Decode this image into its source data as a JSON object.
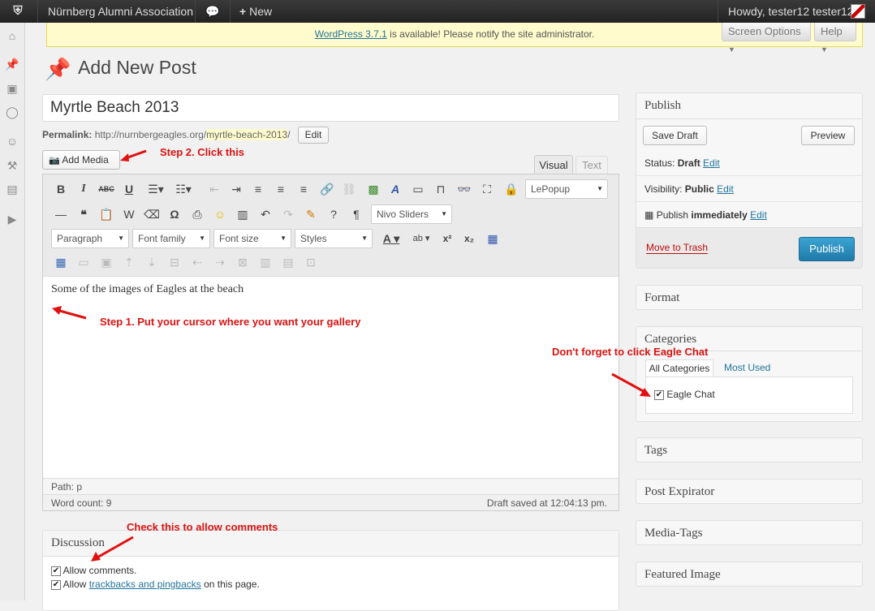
{
  "adminbar": {
    "site_name": "Nürnberg Alumni Association",
    "new_label": "New",
    "howdy": "Howdy, tester12 tester12"
  },
  "notice": {
    "link": "WordPress 3.7.1",
    "text": " is available! Please notify the site administrator."
  },
  "screen_options": "Screen Options",
  "help": "Help",
  "page_title": "Add New Post",
  "post_title": "Myrtle Beach 2013",
  "permalink": {
    "label": "Permalink:",
    "base": "http://nurnbergeagles.org/",
    "slug": "myrtle-beach-2013",
    "trail": "/",
    "edit": "Edit"
  },
  "add_media": "Add Media",
  "tabs": {
    "visual": "Visual",
    "text": "Text"
  },
  "toolbar": {
    "lepopup": "LePopup",
    "nivo": "Nivo Sliders",
    "format": "Paragraph",
    "font_family": "Font family",
    "font_size": "Font size",
    "styles": "Styles"
  },
  "editor": {
    "content": "Some of the images of Eagles at the beach",
    "path": "Path: p",
    "word_count": "Word count: 9",
    "draft_saved": "Draft saved at 12:04:13 pm."
  },
  "annotations": {
    "step2": "Step 2. Click this",
    "step1": "Step 1. Put your cursor where you want your gallery",
    "eagle_chat": "Don't forget to click Eagle Chat",
    "comments": "Check this to allow comments"
  },
  "discussion": {
    "title": "Discussion",
    "allow_comments": "Allow comments.",
    "allow_tb_pre": "Allow ",
    "allow_tb_link": "trackbacks and pingbacks",
    "allow_tb_post": " on this page."
  },
  "publish": {
    "title": "Publish",
    "save_draft": "Save Draft",
    "preview": "Preview",
    "status_label": "Status: ",
    "status_value": "Draft",
    "visibility_label": "Visibility: ",
    "visibility_value": "Public",
    "immediately_label": "Publish ",
    "immediately_value": "immediately",
    "edit": "Edit",
    "trash": "Move to Trash",
    "publish_btn": "Publish"
  },
  "format_box": "Format",
  "categories": {
    "title": "Categories",
    "tab_all": "All Categories",
    "tab_most": "Most Used",
    "item": "Eagle Chat"
  },
  "tags_box": "Tags",
  "expirator_box": "Post Expirator",
  "mediatags_box": "Media-Tags",
  "featured_box": "Featured Image",
  "colors": {
    "accent": "#21759b",
    "publish": "#2a95c5",
    "annotation": "#dd1111"
  }
}
